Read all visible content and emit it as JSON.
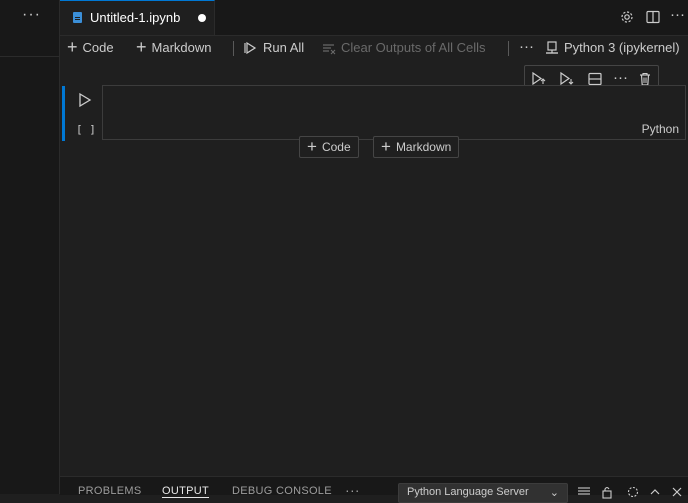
{
  "sidebar": {
    "more_label": "···"
  },
  "tab": {
    "title": "Untitled-1.ipynb",
    "icon": "notebook-file-icon",
    "dirty": true
  },
  "tab_actions": [
    {
      "name": "gear-icon"
    },
    {
      "name": "split-editor-icon"
    },
    {
      "name": "more-icon",
      "label": "···"
    }
  ],
  "toolbar": {
    "code_label": "Code",
    "markdown_label": "Markdown",
    "run_all_label": "Run All",
    "clear_outputs_label": "Clear Outputs of All Cells",
    "more_label": "···",
    "kernel_label": "Python 3 (ipykernel)"
  },
  "cell": {
    "execution_count": "[ ]",
    "language": "Python",
    "content": ""
  },
  "cell_toolbar": [
    {
      "name": "run-above-icon"
    },
    {
      "name": "run-below-icon"
    },
    {
      "name": "split-cell-icon"
    },
    {
      "name": "more-icon",
      "label": "···"
    },
    {
      "name": "delete-icon"
    }
  ],
  "insert": {
    "code_label": "Code",
    "markdown_label": "Markdown"
  },
  "panel": {
    "tabs": [
      "PROBLEMS",
      "OUTPUT",
      "DEBUG CONSOLE"
    ],
    "active_tab": "OUTPUT",
    "more_label": "···",
    "output_channel": "Python Language Server"
  },
  "colors": {
    "accent": "#0078d4",
    "background": "#1f1f1f",
    "sidebar": "#181818"
  }
}
